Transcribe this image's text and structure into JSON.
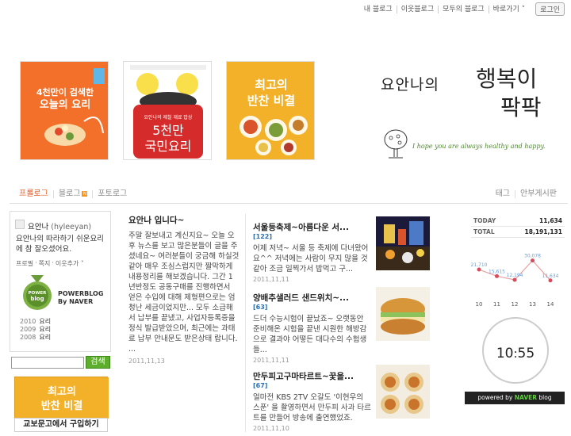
{
  "nav": {
    "links": [
      "내 블로그",
      "이웃블로그",
      "모두의 블로그",
      "바로가기 ˅"
    ],
    "login": "로그인"
  },
  "books": [
    {
      "title_lines": [
        "4천만이 검색한",
        "오늘의 요리"
      ],
      "color": "#f3702a"
    },
    {
      "title_lines": [
        "5천만",
        "국민요리"
      ],
      "color": "#d52b2b"
    },
    {
      "title_lines": [
        "최고의",
        "반찬 비결"
      ],
      "color": "#f3b129"
    }
  ],
  "blog": {
    "title_part1": "요안나의",
    "title_part2": "행복이",
    "title_part3": "팍팍",
    "tagline": "I hope you are always healthy and happy."
  },
  "menu": {
    "left": [
      "프롤로그",
      "블로그",
      "포토로그"
    ],
    "right": [
      "태그",
      "안부게시판"
    ]
  },
  "profile": {
    "name": "요안나",
    "id": "(hyleeyan)",
    "intro": "요안나의 따라하기 쉬운요리에 참 잘오셨어요.",
    "links": [
      "프로필",
      "쪽지",
      "이웃추가 ˅"
    ],
    "badge_line1": "POWERBLOG",
    "badge_line2": "By NAVER",
    "badge_word1": "POWER",
    "badge_word2": "blog",
    "years": [
      {
        "year": "2010",
        "label": "요리"
      },
      {
        "year": "2009",
        "label": "요리"
      },
      {
        "year": "2008",
        "label": "요리"
      }
    ]
  },
  "search": {
    "button": "검색",
    "value": ""
  },
  "sidebar_book": {
    "line1": "최고의",
    "line2": "반찬 비결",
    "buy": "교보문고에서 구입하기"
  },
  "main_post": {
    "title": "요안나 입니다~",
    "body": "주말 잘보내고 계신지요~ 오늘 오후 뉴스를 보고 많은분들이 글을 주셨네요~ 여러분들이 궁금해 하실것 같아 매우 조심스럽지만 짤막하게 내용정리를 해보겠습니다. 그간 1년반정도 공동구매를 진행하면서 얻은 수입에 대해 제형편으로는 엄청난 세금이었지만... 모두 소급해서 납부를 끝냈고, 사업자등록증을 정식 발급받았으며, 최근에는 과태료 납부 안내문도 받은상태 랍니다. ...",
    "date": "2011,11,13"
  },
  "posts": [
    {
      "title": "서울등축제~아름다운 서...",
      "count": "[122]",
      "body": "어제 저녁~ 서울 등 축제에 다녀왔어요^^ 저녁에는 사람이 무지 많을 것같아 조금 일찍가서 밥먹고 구...",
      "date": "2011,11,11"
    },
    {
      "title": "양배추샐러드 샌드위치~...",
      "count": "[63]",
      "body": "드더 수능시험이 끝났죠~ 오랫동안 준비해온 시험을 끝낸 시원한 해방감으로 결과야 어떻든 대다수의 수험생들...",
      "date": "2011,11,11"
    },
    {
      "title": "만두피고구마타르트~꿏을...",
      "count": "[67]",
      "body": "얼마전 KBS 2TV 오갈도 '이현우의 스푼' 을 촬영하면서 만두피 사과 타르트를 만들어 방송에 출연했었죠.",
      "date": "2011,11,10"
    }
  ],
  "stats": {
    "today_label": "TODAY",
    "today_value": "11,634",
    "total_label": "TOTAL",
    "total_value": "18,191,131"
  },
  "chart_data": {
    "type": "line",
    "x": [
      "10",
      "11",
      "12",
      "13",
      "14"
    ],
    "values": [
      21710,
      15615,
      12194,
      30078,
      11634
    ],
    "value_labels": [
      "21,710",
      "15,615",
      "12,194",
      "30,078",
      "11,634"
    ],
    "line_color": "#e8a0a0",
    "point_color": "#d94a5b",
    "label_color": "#6a9fd8"
  },
  "clock": {
    "hour": "10",
    "minute": "55"
  },
  "powered": {
    "prefix": "powered by",
    "brand": "NAVER",
    "suffix": "blog"
  }
}
